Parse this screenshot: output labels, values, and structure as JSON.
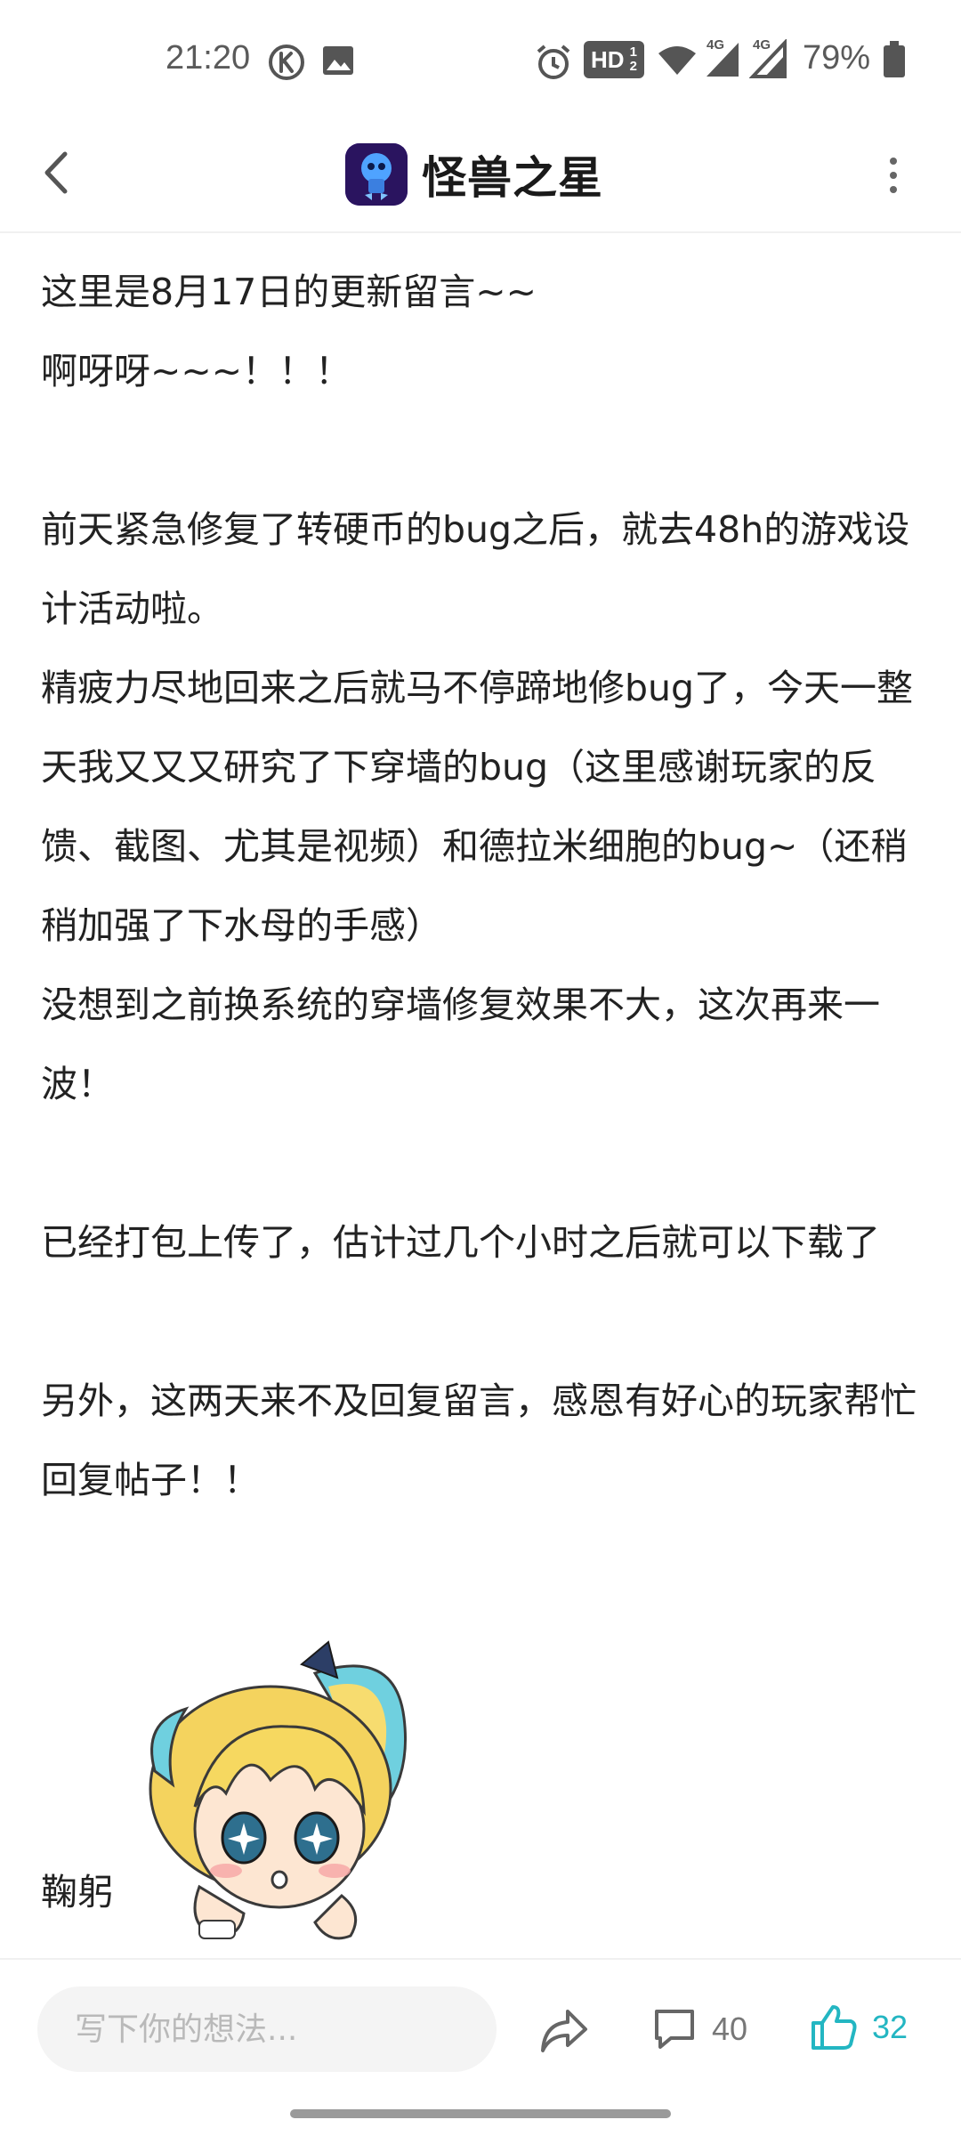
{
  "status_bar": {
    "time": "21:20",
    "network_badge": "HD",
    "network_1": "4G",
    "network_2": "4G",
    "battery_pct": "79%",
    "icons": [
      "k-icon",
      "gallery-icon",
      "alarm-icon",
      "hd-icon",
      "wifi-icon",
      "signal-icon",
      "signal-icon",
      "battery-icon"
    ]
  },
  "header": {
    "title": "怪兽之星",
    "back_icon": "chevron-left-icon",
    "more_icon": "more-vertical-icon"
  },
  "article": {
    "paragraphs": [
      "这里是8月17日的更新留言~~",
      "啊呀呀~~~！！！",
      "",
      "前天紧急修复了转硬币的bug之后，就去48h的游戏设计活动啦。",
      "精疲力尽地回来之后就马不停蹄地修bug了，今天一整天我又又又研究了下穿墙的bug（这里感谢玩家的反馈、截图、尤其是视频）和德拉米细胞的bug~（还稍稍加强了下水母的手感）",
      "没想到之前换系统的穿墙修复效果不大，这次再来一波！",
      "",
      "已经打包上传了，估计过几个小时之后就可以下载了",
      "",
      "另外，这两天来不及回复留言，感恩有好心的玩家帮忙回复帖子！！"
    ],
    "signature": "鞠躬",
    "sticker": "chibi-girl-sticker"
  },
  "bottom_bar": {
    "comment_placeholder": "写下你的想法...",
    "comment_count": "40",
    "like_count": "32",
    "icons": [
      "share-icon",
      "comment-icon",
      "thumbs-up-icon"
    ]
  },
  "colors": {
    "accent": "#23b6c2",
    "input_bg": "#f4f4f4",
    "text": "#222222",
    "muted": "#777777"
  }
}
